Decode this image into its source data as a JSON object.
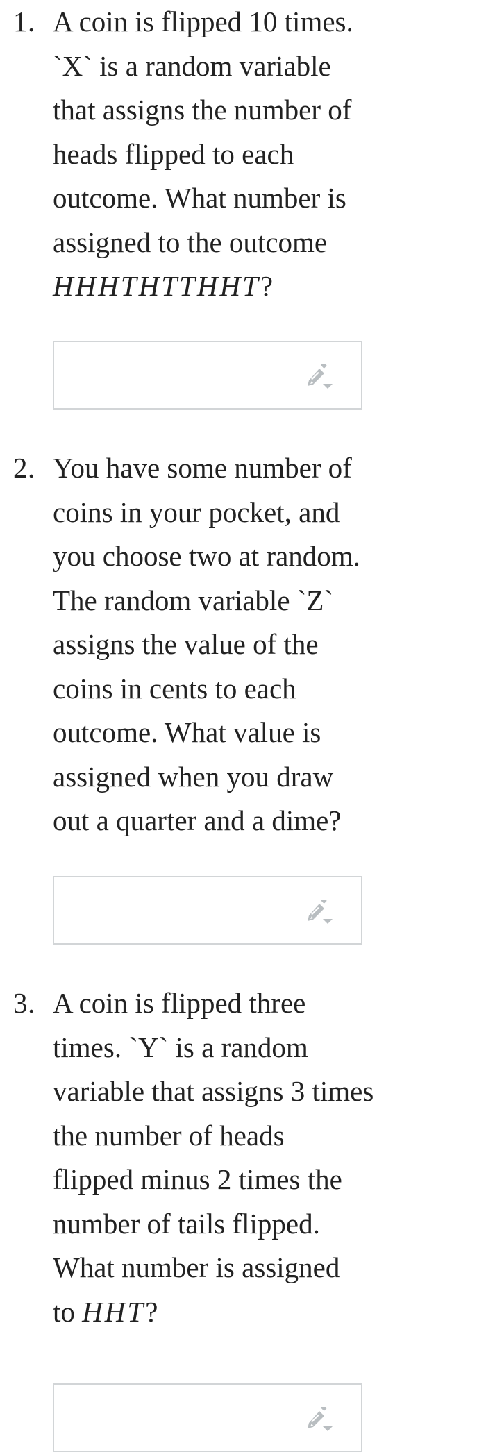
{
  "questions": [
    {
      "number": "1.",
      "lines": [
        {
          "text": "A coin is flipped 10 times."
        },
        {
          "text": "`X` is a random variable"
        },
        {
          "text": "that assigns the number of"
        },
        {
          "text": "heads flipped to each"
        },
        {
          "text": "outcome. What number is"
        },
        {
          "text": "assigned to the outcome"
        },
        {
          "pre": "",
          "math": "HHHTHTTHHT",
          "post": "?"
        }
      ],
      "answer": {
        "value": "",
        "placeholder": ""
      },
      "icon": "pencil-dropdown-icon"
    },
    {
      "number": "2.",
      "lines": [
        {
          "text": "You have some number of"
        },
        {
          "text": "coins in your pocket, and"
        },
        {
          "text": "you choose two at random."
        },
        {
          "text": "The random variable `Z`"
        },
        {
          "text": "assigns the value of the"
        },
        {
          "text": "coins in cents to each"
        },
        {
          "text": "outcome. What value is"
        },
        {
          "text": "assigned when you draw"
        },
        {
          "text": "out a quarter and a dime?"
        }
      ],
      "answer": {
        "value": "",
        "placeholder": ""
      },
      "icon": "pencil-dropdown-icon"
    },
    {
      "number": "3.",
      "lines": [
        {
          "text": "A coin is flipped three"
        },
        {
          "text": "times. `Y` is a random"
        },
        {
          "text": "variable that assigns 3 times"
        },
        {
          "text": "the number of heads"
        },
        {
          "text": "flipped minus 2 times the"
        },
        {
          "text": "number of tails flipped."
        },
        {
          "text": "What number is assigned"
        },
        {
          "pre": "to ",
          "math": "HHT",
          "post": "?"
        }
      ],
      "answer": {
        "value": "",
        "placeholder": ""
      },
      "icon": "pencil-dropdown-icon"
    }
  ],
  "colors": {
    "text": "#222222",
    "box_border": "#d2d5d7",
    "icon": "#b9bec1"
  }
}
